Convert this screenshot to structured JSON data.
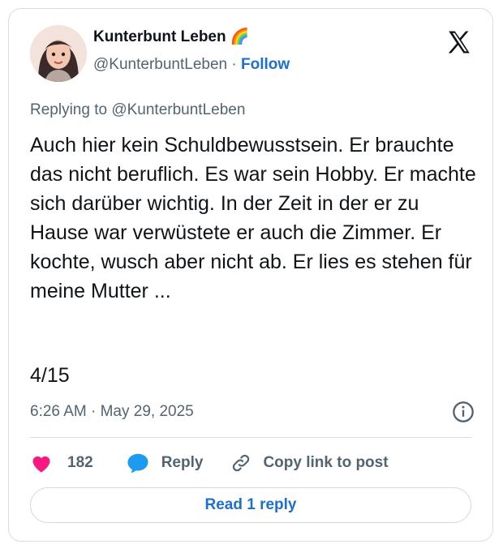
{
  "user": {
    "name": "Kunterbunt Leben 🌈",
    "handle": "@KunterbuntLeben",
    "separator": "·",
    "follow_label": "Follow"
  },
  "replying_to": "Replying to @KunterbuntLeben",
  "post_text": "Auch hier kein Schuldbewusstsein. Er brauchte das nicht beruflich. Es war sein Hobby. Er machte sich darüber wichtig. In der Zeit in der er zu Hause war verwüstete er auch die Zimmer. Er kochte, wusch aber nicht ab. Er lies es stehen für meine Mutter ...",
  "thread_count": "4/15",
  "timestamp": "6:26 AM · May 29, 2025",
  "actions": {
    "like_count": "182",
    "reply_label": "Reply",
    "copy_label": "Copy link to post"
  },
  "read_reply_label": "Read 1 reply",
  "colors": {
    "like": "#f91880",
    "reply": "#1d9bf0",
    "link": "#1d6fd0"
  }
}
